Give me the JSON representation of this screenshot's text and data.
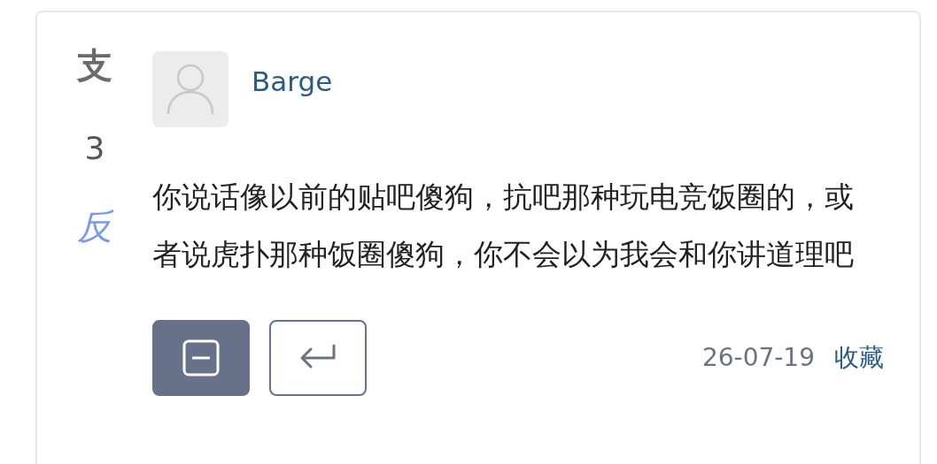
{
  "vote": {
    "up": "支",
    "count": "3",
    "down": "反"
  },
  "author": {
    "name": "Barge"
  },
  "body": "你说话像以前的贴吧傻狗，抗吧那种玩电竞饭圈的，或者说虎扑那种饭圈傻狗，你不会以为我会和你讲道理吧",
  "actions": [
    {
      "kind": "collapse",
      "selected": true
    },
    {
      "kind": "reply",
      "selected": false
    }
  ],
  "date": "26-07-19",
  "favorite_link": "收藏"
}
